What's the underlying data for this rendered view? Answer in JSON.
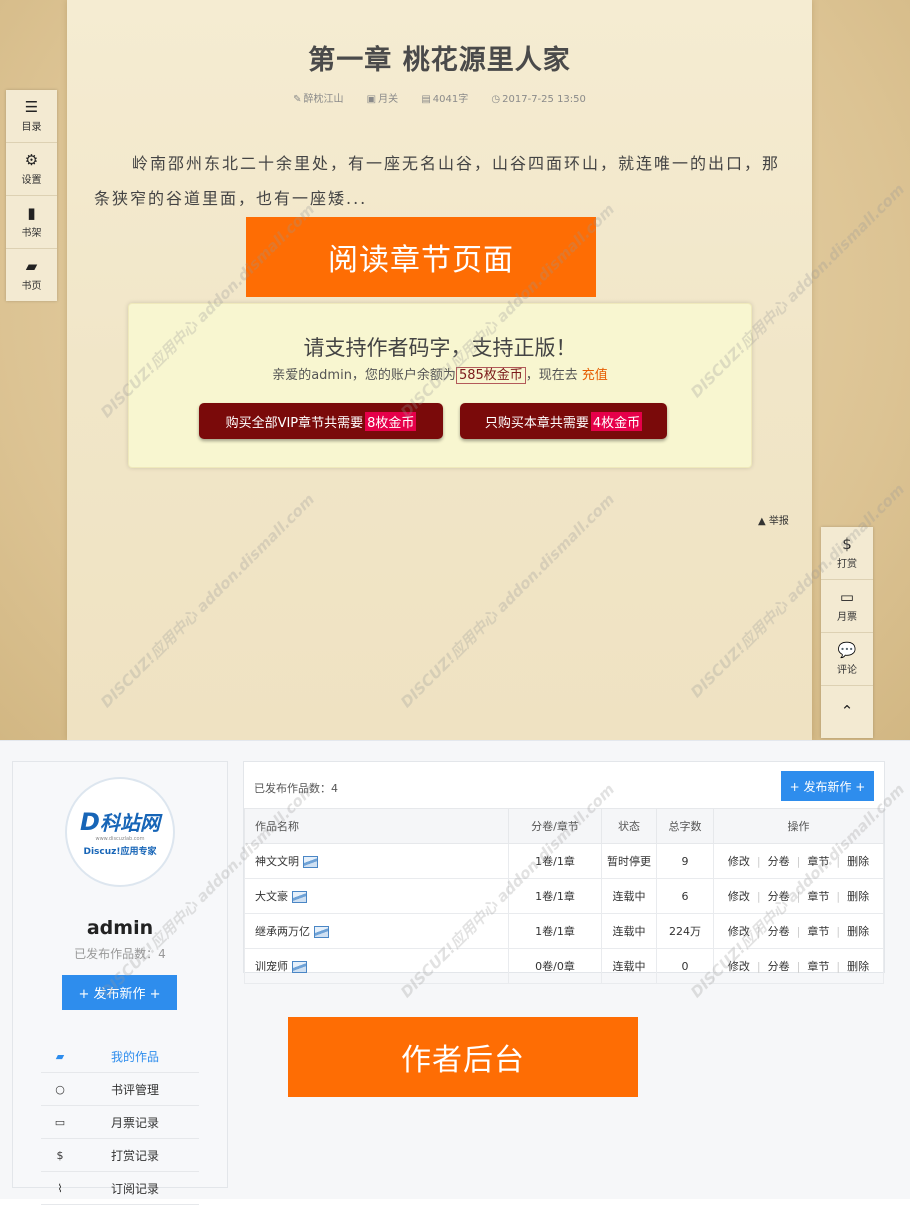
{
  "reader": {
    "title": "第一章 桃花源里人家",
    "meta": {
      "author": "醉枕江山",
      "volume": "月关",
      "words": "4041字",
      "date": "2017-7-25 13:50"
    },
    "excerpt": "岭南邵州东北二十余里处，有一座无名山谷，山谷四面环山，就连唯一的出口，那条狭窄的谷道里面，也有一座矮...",
    "banner": "阅读章节页面",
    "left_tools": [
      {
        "icon": "list-icon",
        "label": "目录"
      },
      {
        "icon": "gear-icon",
        "label": "设置"
      },
      {
        "icon": "bookmark-icon",
        "label": "书架"
      },
      {
        "icon": "book-icon",
        "label": "书页"
      }
    ],
    "right_tools": [
      {
        "icon": "dollar-icon",
        "label": "打赏"
      },
      {
        "icon": "card-icon",
        "label": "月票"
      },
      {
        "icon": "comment-icon",
        "label": "评论"
      },
      {
        "icon": "chevron-up-icon",
        "label": ""
      }
    ],
    "report": "举报",
    "pay": {
      "title": "请支持作者码字，支持正版！",
      "prefix": "亲爱的admin，您的账户余额为",
      "balance": "585枚金币",
      "suffix": "，现在去",
      "recharge": "充值",
      "buy_all_label": "购买全部VIP章节共需要",
      "buy_all_price": "8枚金币",
      "buy_one_label": "只购买本章共需要",
      "buy_one_price": "4枚金币"
    }
  },
  "dashboard": {
    "banner": "作者后台",
    "logo": {
      "main": "科站网",
      "sub": "Discuz!应用专家",
      "tiny": "www.discuzlab.com"
    },
    "username": "admin",
    "published_count": "已发布作品数：4",
    "publish_button": "+ 发布新作 +",
    "menu": [
      {
        "icon": "book-icon",
        "label": "我的作品",
        "active": true
      },
      {
        "icon": "comment-icon",
        "label": "书评管理",
        "active": false
      },
      {
        "icon": "card-icon",
        "label": "月票记录",
        "active": false
      },
      {
        "icon": "dollar-icon",
        "label": "打赏记录",
        "active": false
      },
      {
        "icon": "rss-icon",
        "label": "订阅记录",
        "active": false
      }
    ],
    "works": {
      "count_label": "已发布作品数：4",
      "publish_button": "+ 发布新作 +",
      "columns": [
        "作品名称",
        "分卷/章节",
        "状态",
        "总字数",
        "操作"
      ],
      "rows": [
        {
          "name": "神文文明",
          "chapters": "1卷/1章",
          "status": "暂时停更",
          "words": "9"
        },
        {
          "name": "大文豪",
          "chapters": "1卷/1章",
          "status": "连载中",
          "words": "6"
        },
        {
          "name": "继承两万亿",
          "chapters": "1卷/1章",
          "status": "连载中",
          "words": "224万"
        },
        {
          "name": "训宠师",
          "chapters": "0卷/0章",
          "status": "连载中",
          "words": "0"
        }
      ],
      "actions": [
        "修改",
        "分卷",
        "章节",
        "删除"
      ]
    }
  },
  "watermark": "DISCUZ!应用中心 addon.dismall.com"
}
